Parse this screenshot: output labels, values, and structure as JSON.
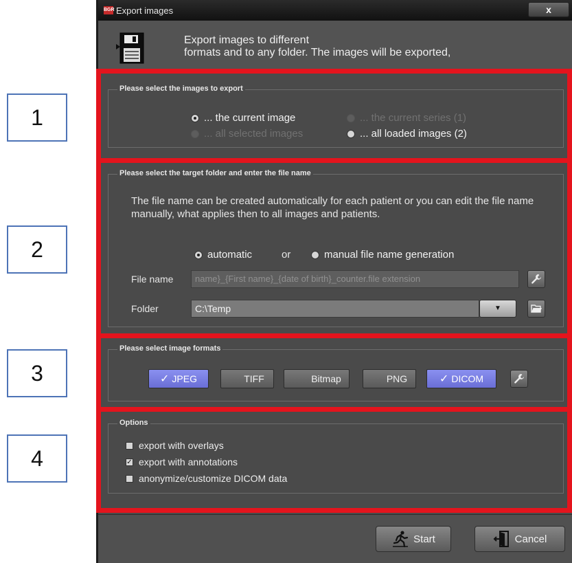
{
  "window": {
    "title": "Export images",
    "close_label": "x",
    "app_icon_text": "BGR",
    "header_lines": [
      "Export images to different",
      "formats and to any folder. The images will be exported,"
    ]
  },
  "section1": {
    "title": "Please select the images to export",
    "options": [
      {
        "label": "... the current image",
        "checked": true,
        "enabled": true
      },
      {
        "label": "... the current series (1)",
        "checked": false,
        "enabled": false
      },
      {
        "label": "... all selected images",
        "checked": false,
        "enabled": false
      },
      {
        "label": "... all loaded images (2)",
        "checked": false,
        "enabled": true
      }
    ]
  },
  "section2": {
    "title": "Please select the target folder and enter the file name",
    "description": "The file name can be created automatically for each patient or you can edit the file name manually, what applies then to all images and patients.",
    "mode_automatic": "automatic",
    "mode_or": "or",
    "mode_manual": "manual file name generation",
    "file_name_label": "File name",
    "file_name_value": "name}_{First name}_{date of birth}_counter.file extension",
    "folder_label": "Folder",
    "folder_value": "C:\\Temp"
  },
  "section3": {
    "title": "Please select image formats",
    "formats": [
      {
        "label": "JPEG",
        "checked": true
      },
      {
        "label": "TIFF",
        "checked": false
      },
      {
        "label": "Bitmap",
        "checked": false
      },
      {
        "label": "PNG",
        "checked": false
      },
      {
        "label": "DICOM",
        "checked": true
      }
    ]
  },
  "section4": {
    "title": "Options",
    "options": [
      {
        "label": "export with overlays",
        "checked": false
      },
      {
        "label": "export with annotations",
        "checked": true
      },
      {
        "label": "anonymize/customize DICOM data",
        "checked": false
      }
    ]
  },
  "footer": {
    "start_label": "Start",
    "cancel_label": "Cancel"
  },
  "annotations": [
    "1",
    "2",
    "3",
    "4"
  ],
  "colors": {
    "highlight_red": "#e4141d",
    "annotation_blue": "#4d73b6",
    "format_selected": "#7a80e8"
  },
  "icons": {
    "disk": "floppy-disk-icon",
    "settings": "wrench-icon",
    "folder": "folder-open-icon",
    "start": "running-man-icon",
    "cancel": "exit-door-icon"
  }
}
